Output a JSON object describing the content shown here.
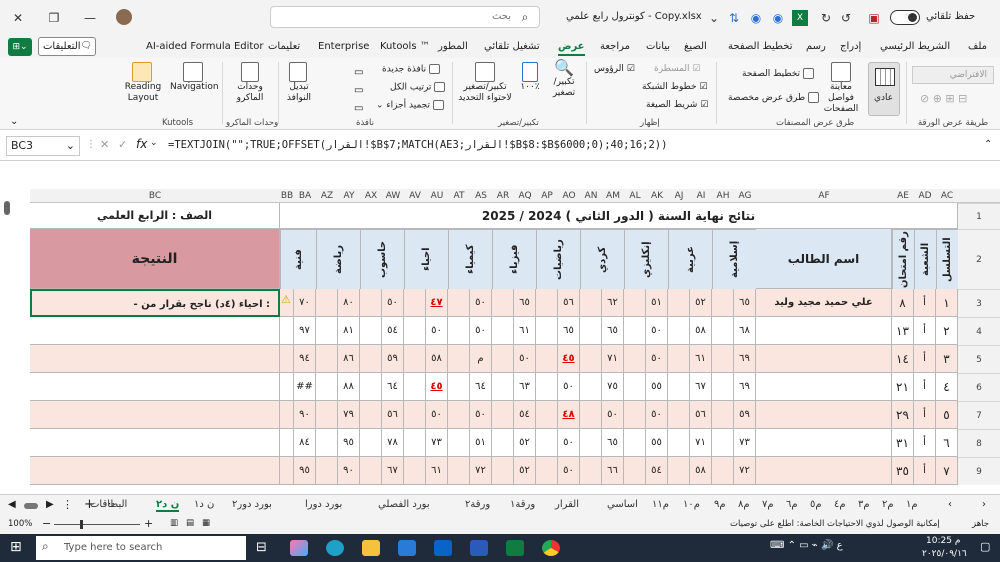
{
  "titlebar": {
    "autosave": "حفظ تلقائي",
    "filename": "كونترول رابع علمي - Copy.xlsx",
    "search_placeholder": "بحث"
  },
  "menu": {
    "items": [
      "ملف",
      "الشريط الرئيسي",
      "إدراج",
      "رسم",
      "تخطيط الصفحة",
      "الصيغ",
      "بيانات",
      "مراجعة",
      "عرض",
      "تشغيل تلقائي",
      "المطور",
      "Kutools ™",
      "Enterprise",
      "تعليمات",
      "AI-aided Formula Editor"
    ],
    "comments": "التعليقات"
  },
  "ribbon": {
    "g_workbook_views": "طرق عرض المصنفات",
    "normal": "عادي",
    "page_break": "معاينة فواصل الصفحات",
    "page_layout": "تخطيط الصفحة",
    "custom_views": "طرق عرض مخصصة",
    "g_show": "إظهار",
    "ruler": "المسطرة",
    "gridlines": "خطوط الشبكة",
    "formula_bar": "شريط الصيغة",
    "headings": "الرؤوس",
    "g_zoom": "تكبير/تصغير",
    "zoom": "تكبير/ تصغير",
    "zoom100": "١٠٠٪",
    "zoom_sel": "تكبير/تصغير لاحتواء التحديد",
    "g_window": "نافذة",
    "new_window": "نافذة جديدة",
    "arrange_all": "ترتيب الكل",
    "freeze": "تجميد أجزاء",
    "switch_windows": "تبديل النوافذ",
    "g_macros": "وحدات الماكرو",
    "macros": "وحدات الماكرو",
    "g_kutools": "Kutools",
    "navigation": "Navigation",
    "reading_layout": "Reading Layout",
    "g_sheet_view": "طريقة عرض الورقة",
    "default": "الافتراضي"
  },
  "formula_bar": {
    "name_box": "BC3",
    "formula": "=TEXTJOIN(\"\";TRUE;OFFSET(القرار!$B$7;MATCH(AE3;القرار!$B$8:$B$6000;0);40;16;2))"
  },
  "columns": [
    "AC",
    "AD",
    "AE",
    "AF",
    "AG",
    "AH",
    "AI",
    "AJ",
    "AK",
    "AL",
    "AM",
    "AN",
    "AO",
    "AP",
    "AQ",
    "AR",
    "AS",
    "AT",
    "AU",
    "AV",
    "AW",
    "AX",
    "AY",
    "AZ",
    "BA",
    "BB",
    "BC"
  ],
  "sheet": {
    "title": "نتائج نهاية السنة ( الدور الثاني ) 2024 / 2025",
    "class_label": "الصف : الرابع العلمي",
    "headers": {
      "serial": "التسلسل",
      "section": "الشعبة",
      "exam_no": "رقم امتحان",
      "student_name": "اسم الطالب",
      "result": "النتيجة",
      "subjects": [
        "إسلامية",
        "عربية",
        "إنكليزي",
        "كردي",
        "رياضيات",
        "فيزياء",
        "كيمياء",
        "احياء",
        "حاسوب",
        "رياضة",
        "فنية"
      ]
    },
    "rows": [
      {
        "serial": "١",
        "section": "أ",
        "exam": "٨",
        "name": "علي حميد مجيد وليد",
        "scores": [
          "٦٥",
          "٥٢",
          "٥١",
          "٦٢",
          "٥٦",
          "٦٥",
          "٥٠",
          "٤٧",
          "٥٠",
          "٨٠",
          "٧٠"
        ],
        "red": [
          7
        ],
        "result": "- احياء (٤د) ناجح  بقرار من :"
      },
      {
        "serial": "٢",
        "section": "أ",
        "exam": "١٣",
        "name": "",
        "scores": [
          "٦٨",
          "٥٨",
          "٥٠",
          "٦٥",
          "٦٥",
          "٦١",
          "٥٠",
          "٥٠",
          "٥٤",
          "٨١",
          "٩٧"
        ],
        "red": [],
        "result": ""
      },
      {
        "serial": "٣",
        "section": "أ",
        "exam": "١٤",
        "name": "",
        "scores": [
          "٦٩",
          "٦١",
          "٥٠",
          "٧١",
          "٤٥",
          "٥٠",
          "م",
          "٥٨",
          "٥٩",
          "٨٦",
          "٩٤"
        ],
        "red": [
          4
        ],
        "result": ""
      },
      {
        "serial": "٤",
        "section": "أ",
        "exam": "٢١",
        "name": "",
        "scores": [
          "٦٩",
          "٦٧",
          "٥٥",
          "٧٥",
          "٥٠",
          "٦٣",
          "٦٤",
          "٤٥",
          "٦٤",
          "٨٨",
          "##"
        ],
        "red": [
          7
        ],
        "result": ""
      },
      {
        "serial": "٥",
        "section": "أ",
        "exam": "٢٩",
        "name": "",
        "scores": [
          "٥٩",
          "٥٦",
          "٥٠",
          "٥٠",
          "٤٨",
          "٥٤",
          "٥٠",
          "٥٠",
          "٥٦",
          "٧٩",
          "٩٠"
        ],
        "red": [
          4
        ],
        "result": ""
      },
      {
        "serial": "٦",
        "section": "أ",
        "exam": "٣١",
        "name": "",
        "scores": [
          "٧٣",
          "٧١",
          "٥٥",
          "٦٥",
          "٥٠",
          "٥٢",
          "٥١",
          "٧٣",
          "٧٨",
          "٩٥",
          "٨٤"
        ],
        "red": [],
        "result": ""
      },
      {
        "serial": "٧",
        "section": "أ",
        "exam": "٣٥",
        "name": "",
        "scores": [
          "٧٢",
          "٥٨",
          "٥٤",
          "٦٦",
          "٥٠",
          "٥٢",
          "٧٢",
          "٦١",
          "٦٧",
          "٩٠",
          "٩٥"
        ],
        "red": [],
        "result": ""
      }
    ],
    "row_numbers": [
      "1",
      "2",
      "3",
      "4",
      "5",
      "6",
      "7",
      "8",
      "9"
    ]
  },
  "sheet_tabs": [
    "م١",
    "م٢",
    "م٣",
    "م٤",
    "م٥",
    "م٦",
    "م٧",
    "م٨",
    "م٩",
    "م١٠",
    "م١١",
    "اساسي",
    "القرار",
    "ورقة١",
    "ورقة٢",
    "بورد الفصلي",
    "بورد دورا",
    "بورد دور٢",
    "ن د١",
    "ن د٢",
    "البطاقات"
  ],
  "status": {
    "ready": "جاهز",
    "accessibility": "إمكانية الوصول لذوي الاحتياجات الخاصة: اطلع على توصيات",
    "zoom": "100%"
  },
  "taskbar": {
    "search_placeholder": "Type here to search",
    "time": "10:25 م",
    "date": "٢٠٢٥/٠٩/١٦"
  }
}
